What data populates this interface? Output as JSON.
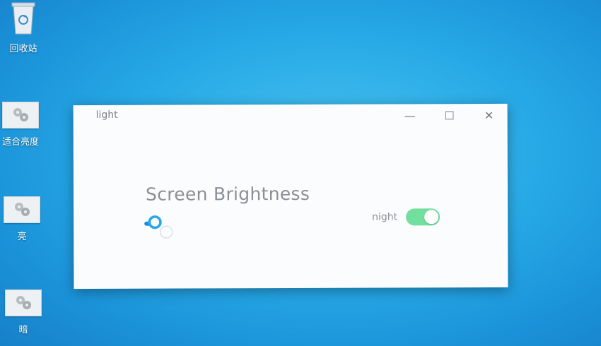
{
  "desktop": {
    "icons": [
      {
        "name": "recycle-bin",
        "label": "回收站"
      },
      {
        "name": "fit-brightness",
        "label": "适合亮度"
      },
      {
        "name": "bright",
        "label": "亮"
      },
      {
        "name": "dark",
        "label": "暗"
      }
    ]
  },
  "window": {
    "title": "light",
    "minimize_glyph": "—",
    "maximize_glyph": "☐",
    "close_glyph": "✕",
    "heading": "Screen Brightness",
    "brightness_level": 0.03,
    "toggle_label": "night",
    "toggle_on": true,
    "toggle_color": "#72df9f",
    "slider_color": "#28a6e8"
  }
}
